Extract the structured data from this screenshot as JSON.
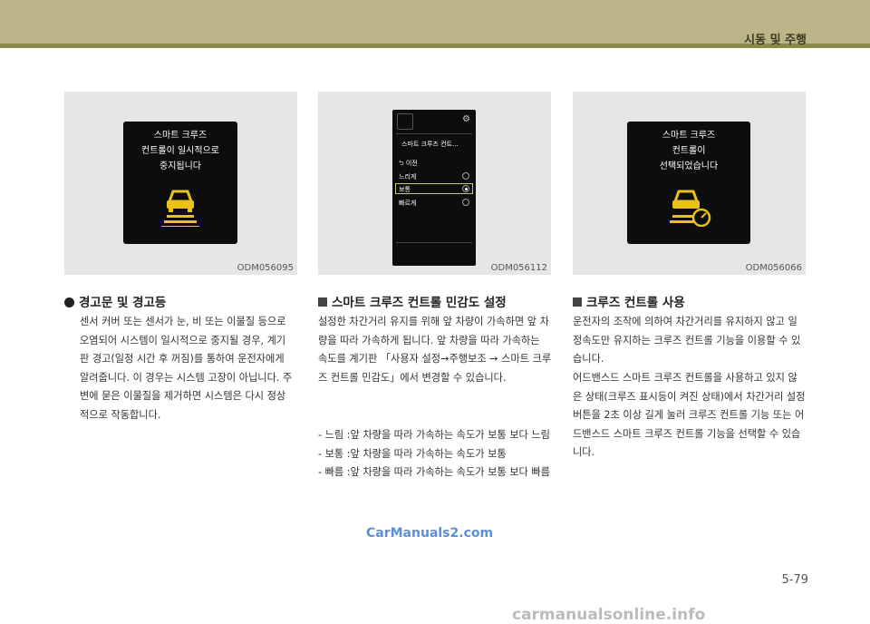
{
  "header": {
    "section": "시동 및 주행"
  },
  "figures": [
    {
      "id": "ODM056095",
      "lines": [
        "스마트 크루즈",
        "컨트롤이 일시적으로",
        "중지됩니다"
      ]
    },
    {
      "id": "ODM056112",
      "menu_title": "스마트 크루즈 컨트...",
      "back": "⮌ 이전",
      "options": [
        "느리게",
        "보통",
        "빠르게"
      ]
    },
    {
      "id": "ODM056066",
      "lines": [
        "스마트 크루즈",
        "컨트롤이",
        "선택되었습니다"
      ]
    }
  ],
  "col1": {
    "heading": "경고문 및 경고등",
    "body": "센서 커버 또는 센서가 눈, 비 또는 이물질 등으로 오염되어 시스템이 일시적으로 중지될 경우, 계기판 경고(일정 시간 후 꺼짐)를 통하여 운전자에게 알려줍니다. 이 경우는 시스템 고장이 아닙니다. 주변에 묻은 이물질을 제거하면 시스템은 다시 정상적으로 작동합니다."
  },
  "col2": {
    "heading": "스마트 크루즈 컨트롤 민감도 설정",
    "body": "설정한 차간거리 유지를 위해 앞 차량이 가속하면 앞 차량을 따라 가속하게 됩니다. 앞 차량을 따라 가속하는 속도를 계기판 「사용자 설정→주행보조 → 스마트 크루즈 컨트롤 민감도」에서 변경할 수 있습니다.",
    "items": [
      {
        "term": "- 느림 : ",
        "desc": "앞 차량을 따라 가속하는 속도가 보통 보다 느림"
      },
      {
        "term": "- 보통 : ",
        "desc": "앞 차량을 따라 가속하는 속도가 보통"
      },
      {
        "term": "- 빠름 : ",
        "desc": "앞 차량을 따라 가속하는 속도가 보통 보다 빠름"
      }
    ]
  },
  "col3": {
    "heading": "크루즈 컨트롤 사용",
    "body1": "운전자의 조작에 의하여 차간거리를 유지하지 않고 일정속도만 유지하는 크루즈 컨트롤 기능을 이용할 수 있습니다.",
    "body2": "어드밴스드 스마트 크루즈 컨트롤을 사용하고 있지 않은 상태(크루즈 표시등이 켜진 상태)에서 차간거리 설정 버튼을 2초 이상 길게 눌러 크루즈 컨트롤 기능 또는 어드밴스드 스마트 크루즈 컨트롤 기능을 선택할 수 있습니다."
  },
  "watermark": "CarManuals2.com",
  "page": "5-79",
  "site": "carmanualsonline.info",
  "colors": {
    "band": "#bcb58a",
    "band_line": "#8a8a4a",
    "warning_amber": "#e8c21a",
    "menu_highlight": "#c8c87a"
  }
}
